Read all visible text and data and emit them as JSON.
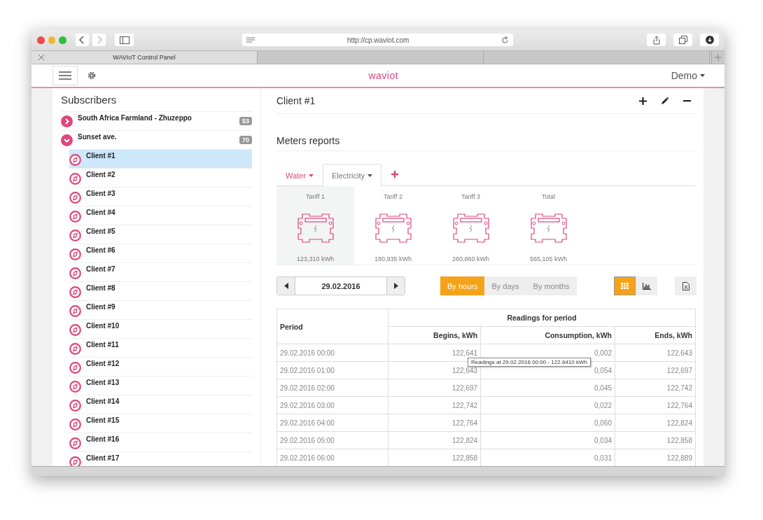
{
  "browser": {
    "url": "http://cp.waviot.com",
    "tabs": [
      {
        "title": "WAVIoT Control Panel",
        "selected": true
      },
      {
        "selected": false
      },
      {
        "selected": false
      }
    ]
  },
  "header": {
    "logo": "waviot",
    "user": "Demo"
  },
  "subscribers": {
    "title": "Subscribers",
    "groups": [
      {
        "name": "South Africa Farmland - Zhuzeppo",
        "count": "53",
        "expanded": false
      },
      {
        "name": "Sunset ave.",
        "count": "70",
        "expanded": true,
        "children": [
          {
            "name": "Client #1",
            "selected": true
          },
          {
            "name": "Client #2",
            "selected": false
          },
          {
            "name": "Client #3",
            "selected": false
          },
          {
            "name": "Client #4",
            "selected": false
          },
          {
            "name": "Client #5",
            "selected": false
          },
          {
            "name": "Client #6",
            "selected": false
          },
          {
            "name": "Client #7",
            "selected": false
          },
          {
            "name": "Client #8",
            "selected": false
          },
          {
            "name": "Client #9",
            "selected": false
          },
          {
            "name": "Client #10",
            "selected": false
          },
          {
            "name": "Client #11",
            "selected": false
          },
          {
            "name": "Client #12",
            "selected": false
          },
          {
            "name": "Client #13",
            "selected": false
          },
          {
            "name": "Client #14",
            "selected": false
          },
          {
            "name": "Client #15",
            "selected": false
          },
          {
            "name": "Client #16",
            "selected": false
          },
          {
            "name": "Client #17",
            "selected": false
          }
        ]
      }
    ]
  },
  "client": {
    "title": "Client #1"
  },
  "reports": {
    "title": "Meters reports",
    "tabs": [
      {
        "label": "Water",
        "selected": false
      },
      {
        "label": "Electricity",
        "selected": true
      }
    ],
    "tariffs": [
      {
        "label": "Tariff 1",
        "value": "123,310 kWh",
        "selected": true
      },
      {
        "label": "Tariff 2",
        "value": "180,935 kWh",
        "selected": false
      },
      {
        "label": "Tariff 3",
        "value": "260,860 kWh",
        "selected": false
      },
      {
        "label": "Total",
        "value": "565,105 kWh",
        "selected": false
      }
    ],
    "date": "29.02.2016",
    "periods": [
      {
        "label": "By hours",
        "selected": true
      },
      {
        "label": "By days",
        "selected": false
      },
      {
        "label": "By months",
        "selected": false
      }
    ],
    "views": [
      {
        "kind": "table",
        "selected": true
      },
      {
        "kind": "chart",
        "selected": false
      }
    ],
    "table": {
      "group_header": "Readings for period",
      "columns": [
        "Period",
        "Begins, kWh",
        "Consumption, kWh",
        "Ends, kWh"
      ],
      "rows": [
        [
          "29.02.2016 00:00",
          "122,641",
          "0,002",
          "122,643"
        ],
        [
          "29.02.2016 01:00",
          "122,643",
          "0,054",
          "122,697"
        ],
        [
          "29.02.2016 02:00",
          "122,697",
          "0,045",
          "122,742"
        ],
        [
          "29.02.2016 03:00",
          "122,742",
          "0,022",
          "122,764"
        ],
        [
          "29.02.2016 04:00",
          "122,764",
          "0,060",
          "122,824"
        ],
        [
          "29.02.2016 05:00",
          "122,824",
          "0,034",
          "122,858"
        ],
        [
          "29.02.2016 06:00",
          "122,858",
          "0,031",
          "122,889"
        ]
      ]
    },
    "tooltip": "Readings at 29.02.2016 00:00 - 122.6410 kWh"
  }
}
